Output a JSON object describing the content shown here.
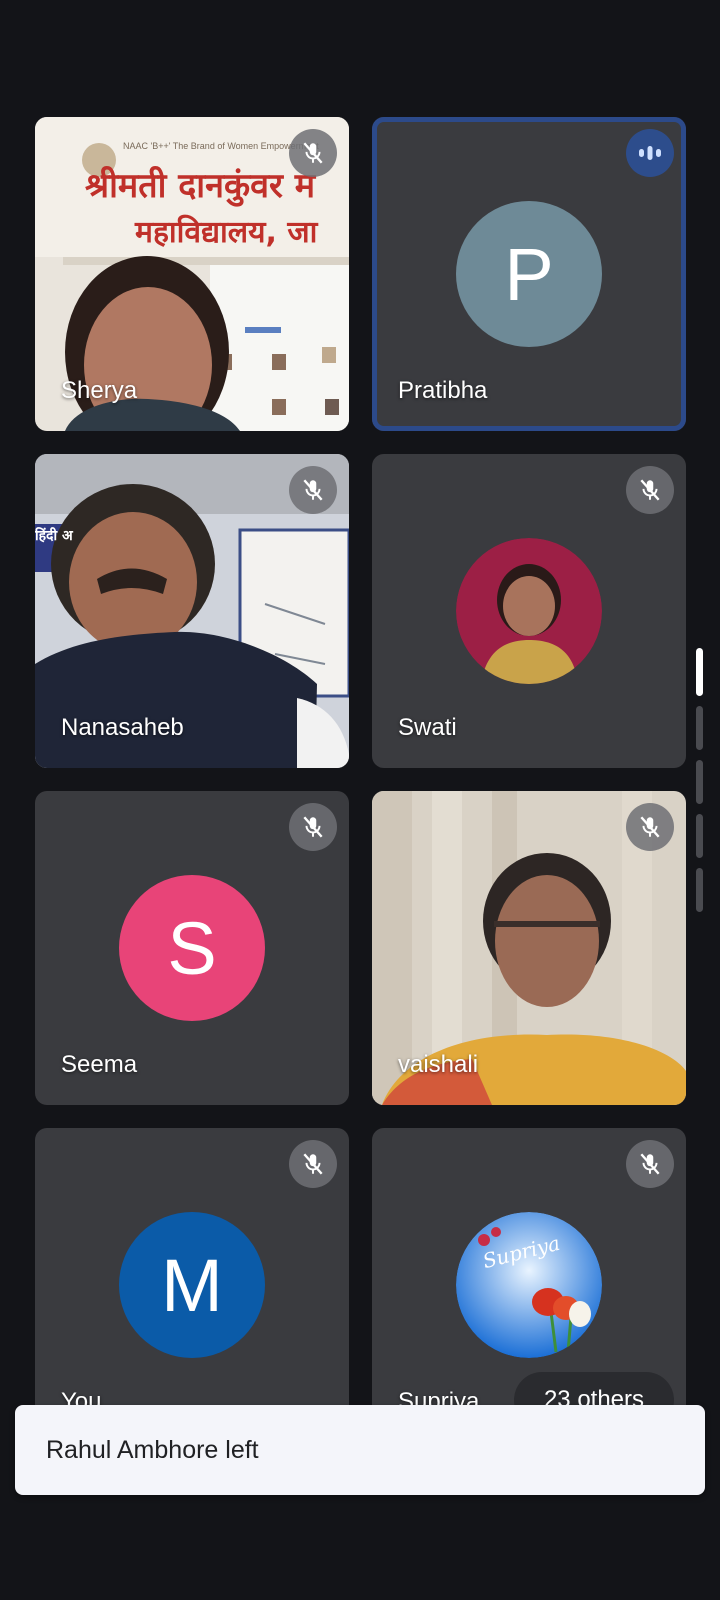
{
  "participants": [
    {
      "name": "Sherya",
      "muted": true,
      "video": true
    },
    {
      "name": "Pratibha",
      "initial": "P",
      "avatar_color": "#6e8a97",
      "speaking": true
    },
    {
      "name": "Nanasaheb",
      "muted": true,
      "video": true
    },
    {
      "name": "Swati",
      "muted": true,
      "photo_avatar": true
    },
    {
      "name": "Seema",
      "initial": "S",
      "avatar_color": "#e84478",
      "muted": true
    },
    {
      "name": "vaishali",
      "muted": true,
      "video": true
    },
    {
      "name": "You",
      "initial": "M",
      "avatar_color": "#0b5ba8",
      "muted": true
    },
    {
      "name": "Supriya",
      "muted": true,
      "photo_avatar": true,
      "avatar_text": "Supriya"
    }
  ],
  "others_label": "23 others",
  "toast_message": "Rahul Ambhore left",
  "sherya_banner": {
    "small_line": "NAAC 'B++' The Brand of Women Empowerment",
    "line1": "श्रीमती दानकुंवर म",
    "line2": "महाविद्यालय, जा"
  },
  "nanasaheb_sign": "हिंदी अ"
}
